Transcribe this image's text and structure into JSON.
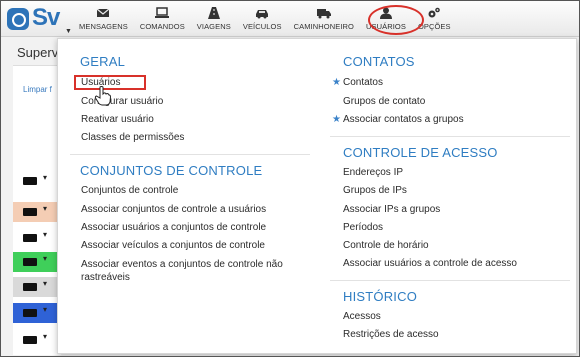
{
  "app": {
    "logo_text": "Sv"
  },
  "nav": [
    {
      "label": "MENSAGENS",
      "icon": "envelope-icon"
    },
    {
      "label": "COMANDOS",
      "icon": "monitor-icon"
    },
    {
      "label": "VIAGENS",
      "icon": "road-icon"
    },
    {
      "label": "VEÍCULOS",
      "icon": "car-icon"
    },
    {
      "label": "CAMINHONEIRO",
      "icon": "truck-driver-icon"
    },
    {
      "label": "USUÁRIOS",
      "icon": "user-icon",
      "active": true
    },
    {
      "label": "OPÇÕES",
      "icon": "gears-icon"
    }
  ],
  "page": {
    "title": "Superv",
    "clear_link": "Limpar f"
  },
  "menu": {
    "geral": {
      "title": "GERAL",
      "items": [
        "Usuários",
        "Configurar usuário",
        "Reativar usuário",
        "Classes de permissões"
      ]
    },
    "conjuntos": {
      "title": "CONJUNTOS DE CONTROLE",
      "items": [
        "Conjuntos de controle",
        "Associar conjuntos de controle a usuários",
        "Associar usuários a conjuntos de controle",
        "Associar veículos a conjuntos de controle",
        "Associar eventos a conjuntos de controle não rastreáveis"
      ]
    },
    "contatos": {
      "title": "CONTATOS",
      "items": [
        "Contatos",
        "Grupos de contato",
        "Associar contatos a grupos"
      ]
    },
    "controle_acesso": {
      "title": "CONTROLE DE ACESSO",
      "items": [
        "Endereços IP",
        "Grupos de IPs",
        "Associar IPs a grupos",
        "Períodos",
        "Controle de horário",
        "Associar usuários a controle de acesso"
      ]
    },
    "historico": {
      "title": "HISTÓRICO",
      "items": [
        "Acessos",
        "Restrições de acesso"
      ]
    }
  },
  "colors": {
    "accent": "#2f7dc2",
    "highlight_red": "#d8312a",
    "row_colors": [
      "#ffffff",
      "#f4cdb4",
      "#ffffff",
      "#3fcf5a",
      "#d9d9d9",
      "#2f62d6",
      "#ffffff"
    ]
  }
}
